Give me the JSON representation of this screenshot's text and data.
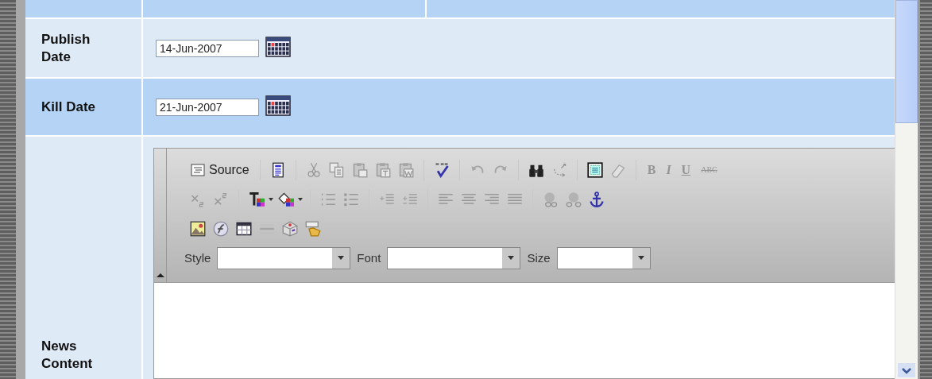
{
  "form_rows": [
    {
      "kind": "date",
      "label": "Publish Date",
      "value": "14-Jun-2007"
    },
    {
      "kind": "date",
      "label": "Kill Date",
      "value": "21-Jun-2007"
    },
    {
      "kind": "editor",
      "label": "News Content"
    }
  ],
  "editor": {
    "toolbar_rows": [
      [
        {
          "kind": "source",
          "label": "Source",
          "disabled": false
        },
        {
          "kind": "sep"
        },
        {
          "kind": "icon",
          "disabled": false
        },
        {
          "kind": "sep"
        },
        {
          "kind": "icon",
          "disabled": true
        },
        {
          "kind": "icon",
          "disabled": true
        },
        {
          "kind": "icon",
          "disabled": true
        },
        {
          "kind": "icon",
          "disabled": true
        },
        {
          "kind": "icon",
          "disabled": true
        },
        {
          "kind": "sep"
        },
        {
          "kind": "icon",
          "disabled": false
        },
        {
          "kind": "sep"
        },
        {
          "kind": "icon",
          "disabled": true
        },
        {
          "kind": "icon",
          "disabled": true
        },
        {
          "kind": "sep"
        },
        {
          "kind": "icon",
          "disabled": false
        },
        {
          "kind": "icon",
          "disabled": true
        },
        {
          "kind": "sep"
        },
        {
          "kind": "icon",
          "disabled": false
        },
        {
          "kind": "icon",
          "disabled": true
        },
        {
          "kind": "sep"
        },
        {
          "kind": "text",
          "label": "B",
          "disabled": true
        },
        {
          "kind": "text",
          "label": "I",
          "disabled": true
        },
        {
          "kind": "text",
          "label": "U",
          "disabled": true
        },
        {
          "kind": "text",
          "label": "ABC",
          "disabled": true
        }
      ],
      [
        {
          "kind": "icon",
          "disabled": true
        },
        {
          "kind": "icon",
          "disabled": true
        },
        {
          "kind": "sep"
        },
        {
          "kind": "icon",
          "disabled": false
        },
        {
          "kind": "icon",
          "disabled": false
        },
        {
          "kind": "sep"
        },
        {
          "kind": "icon",
          "disabled": true
        },
        {
          "kind": "icon",
          "disabled": true
        },
        {
          "kind": "sep"
        },
        {
          "kind": "icon",
          "disabled": true
        },
        {
          "kind": "icon",
          "disabled": true
        },
        {
          "kind": "sep"
        },
        {
          "kind": "icon",
          "disabled": true
        },
        {
          "kind": "icon",
          "disabled": true
        },
        {
          "kind": "icon",
          "disabled": true
        },
        {
          "kind": "icon",
          "disabled": true
        },
        {
          "kind": "sep"
        },
        {
          "kind": "icon",
          "disabled": true
        },
        {
          "kind": "icon",
          "disabled": true
        },
        {
          "kind": "icon",
          "disabled": false
        }
      ],
      [
        {
          "kind": "icon",
          "disabled": false
        },
        {
          "kind": "icon",
          "disabled": false
        },
        {
          "kind": "icon",
          "disabled": false
        },
        {
          "kind": "icon",
          "disabled": true
        },
        {
          "kind": "icon",
          "disabled": false
        },
        {
          "kind": "icon",
          "disabled": false
        }
      ]
    ],
    "combos": [
      {
        "label": "Style"
      },
      {
        "label": "Font"
      },
      {
        "label": "Size"
      }
    ]
  }
}
